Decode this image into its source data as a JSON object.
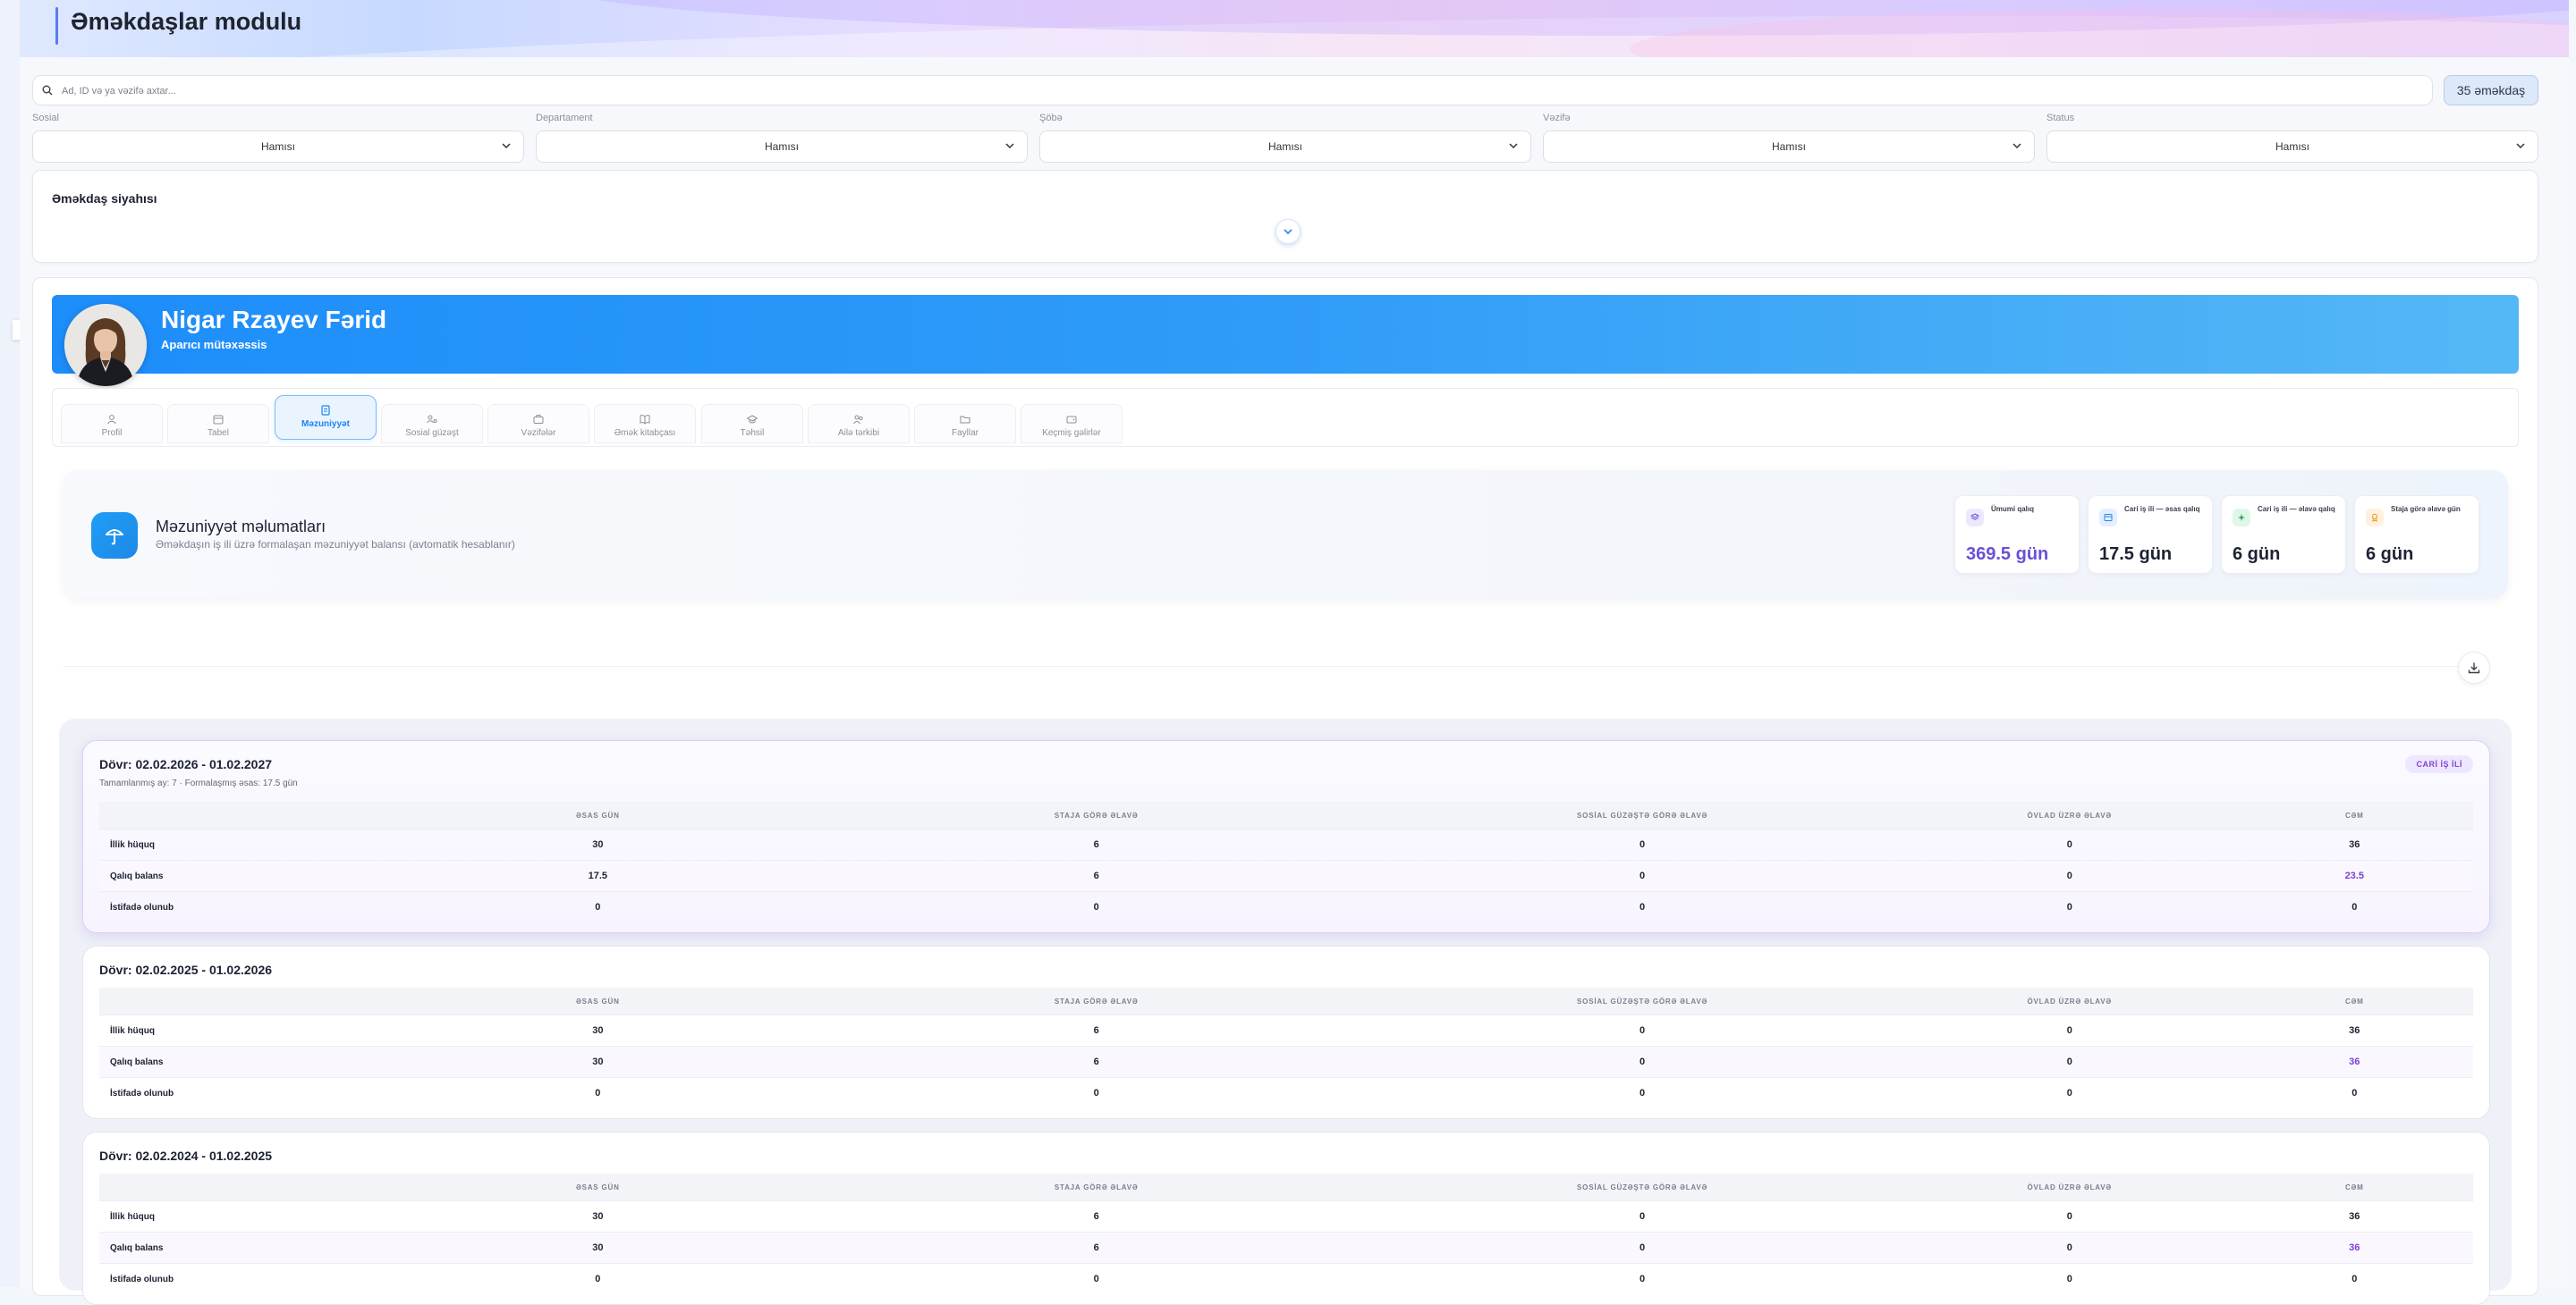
{
  "header": {
    "title": "Əməkdaşlar modulu"
  },
  "search": {
    "placeholder": "Ad, ID və ya vəzifə axtar...",
    "count_label": "35 əməkdaş"
  },
  "filters": [
    {
      "label": "Sosial",
      "value": "Hamısı"
    },
    {
      "label": "Departament",
      "value": "Hamısı"
    },
    {
      "label": "Şöbə",
      "value": "Hamısı"
    },
    {
      "label": "Vəzifə",
      "value": "Hamısı"
    },
    {
      "label": "Status",
      "value": "Hamısı"
    }
  ],
  "employee_list": {
    "title": "Əməkdaş siyahısı"
  },
  "profile": {
    "name": "Nigar Rzayev Fərid",
    "role": "Aparıcı mütəxəssis"
  },
  "tabs": [
    {
      "label": "Profil",
      "icon": "user-icon"
    },
    {
      "label": "Tabel",
      "icon": "calendar-icon"
    },
    {
      "label": "Məzuniyyət",
      "icon": "document-icon",
      "active": true
    },
    {
      "label": "Sosial güzəşt",
      "icon": "users-gear-icon"
    },
    {
      "label": "Vəzifələr",
      "icon": "briefcase-icon"
    },
    {
      "label": "Əmək kitabçası",
      "icon": "book-icon"
    },
    {
      "label": "Təhsil",
      "icon": "graduation-cap-icon"
    },
    {
      "label": "Ailə tərkibi",
      "icon": "family-icon"
    },
    {
      "label": "Fayllar",
      "icon": "folder-icon"
    },
    {
      "label": "Keçmiş gəlirlər",
      "icon": "wallet-icon"
    }
  ],
  "leave": {
    "title": "Məzuniyyət məlumatları",
    "subtitle": "Əməkdaşın iş ili üzrə formalaşan məzuniyyət balansı (avtomatik hesablanır)",
    "stats": [
      {
        "label": "Ümumi qalıq",
        "value": "369.5 gün",
        "color": "#6b4fd8",
        "icon_bg": "#ece8ff",
        "icon": "layers-icon"
      },
      {
        "label": "Cari iş ili — əsas qalıq",
        "value": "17.5 gün",
        "color": "#1d2233",
        "icon_bg": "#e3efff",
        "icon": "calendar-icon"
      },
      {
        "label": "Cari iş ili — əlavə qalıq",
        "value": "6 gün",
        "color": "#1d2233",
        "icon_bg": "#e0f6e8",
        "icon": "sparkle-icon"
      },
      {
        "label": "Staja görə əlavə gün",
        "value": "6 gün",
        "color": "#1d2233",
        "icon_bg": "#fff1dd",
        "icon": "award-icon"
      }
    ]
  },
  "period_table": {
    "columns": [
      "",
      "ƏSAS GÜN",
      "STAJA GÖRƏ ƏLAVƏ",
      "SOSİAL GÜZƏŞTƏ GÖRƏ ƏLAVƏ",
      "ÖVLAD ÜZRƏ ƏLAVƏ",
      "CƏM"
    ],
    "row_labels": [
      "İllik hüquq",
      "Qalıq balans",
      "İstifadə olunub"
    ]
  },
  "periods": [
    {
      "title": "Dövr: 02.02.2026 - 01.02.2027",
      "meta": "Tamamlanmış ay: 7 · Formalaşmış əsas: 17.5 gün",
      "badge": "CARİ İŞ İLİ",
      "rows": [
        [
          "30",
          "6",
          "0",
          "0",
          "36"
        ],
        [
          "17.5",
          "6",
          "0",
          "0",
          "23.5"
        ],
        [
          "0",
          "0",
          "0",
          "0",
          "0"
        ]
      ]
    },
    {
      "title": "Dövr: 02.02.2025 - 01.02.2026",
      "rows": [
        [
          "30",
          "6",
          "0",
          "0",
          "36"
        ],
        [
          "30",
          "6",
          "0",
          "0",
          "36"
        ],
        [
          "0",
          "0",
          "0",
          "0",
          "0"
        ]
      ]
    },
    {
      "title": "Dövr: 02.02.2024 - 01.02.2025",
      "rows": [
        [
          "30",
          "6",
          "0",
          "0",
          "36"
        ],
        [
          "30",
          "6",
          "0",
          "0",
          "36"
        ],
        [
          "0",
          "0",
          "0",
          "0",
          "0"
        ]
      ]
    }
  ]
}
